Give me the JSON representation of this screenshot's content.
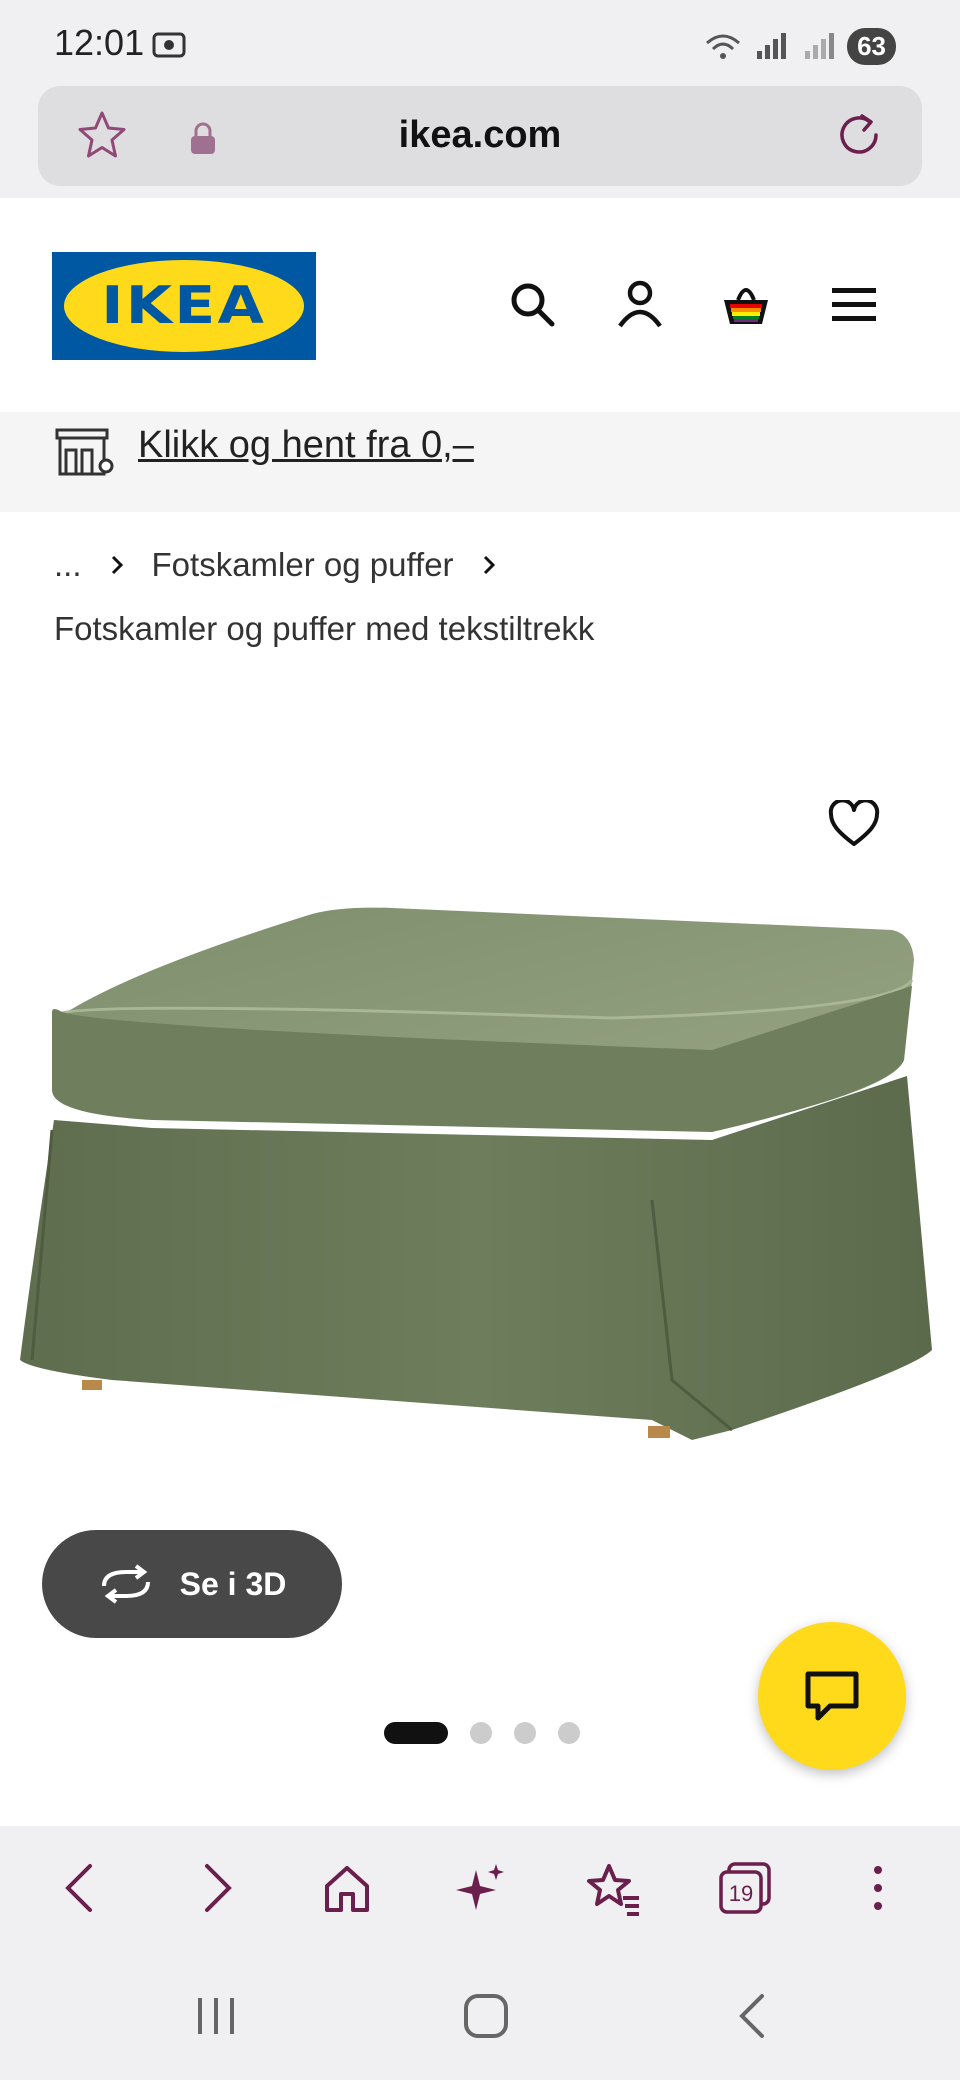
{
  "status_bar": {
    "time": "12:01",
    "battery": "63"
  },
  "browser": {
    "url": "ikea.com"
  },
  "header": {
    "logo_text": "IKEA"
  },
  "pickup_banner": {
    "text": "Klikk og hent fra 0,–"
  },
  "breadcrumb": {
    "ellipsis": "...",
    "category": "Fotskamler og puffer"
  },
  "subcategory": "Fotskamler og puffer med tekstiltrekk",
  "product": {
    "view_3d_label": "Se i 3D",
    "fabric_color": "#6e7e5c",
    "image_count": 4,
    "active_image": 1
  },
  "colors": {
    "ikea_blue": "#0058a3",
    "ikea_yellow": "#ffda1a",
    "browser_accent": "#6b1f4c"
  }
}
